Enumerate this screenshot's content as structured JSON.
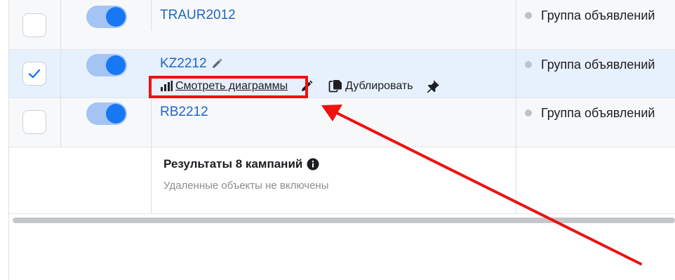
{
  "rows": [
    {
      "name": "TRAUR2012",
      "checked": false,
      "status": "Группа объявлений"
    },
    {
      "name": "KZ2212",
      "checked": true,
      "status": "Группа объявлений"
    },
    {
      "name": "RB2212",
      "checked": false,
      "status": "Группа объявлений"
    }
  ],
  "actions": {
    "view_charts": "Смотреть диаграммы",
    "duplicate": "Дублировать"
  },
  "summary": {
    "title": "Результаты 8 кампаний",
    "subtitle": "Удаленные объекты не включены"
  },
  "icons": {
    "checkmark": "check-icon",
    "edit": "pencil-icon",
    "chart": "bar-chart-icon",
    "duplicate": "duplicate-icon",
    "pin": "pin-icon",
    "info": "info-icon"
  },
  "colors": {
    "accent": "#1877f2",
    "link": "#1d66c2",
    "selected_row": "#e7f0fd",
    "annotation": "#ee1111"
  }
}
